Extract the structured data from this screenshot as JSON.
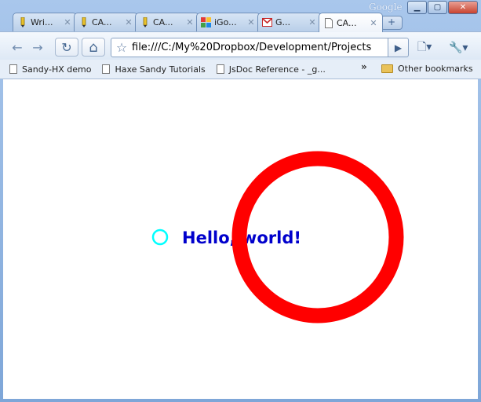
{
  "window": {
    "brand_label": "Google",
    "minimize_label": "▁",
    "maximize_label": "▢",
    "close_label": "✕"
  },
  "tabs": [
    {
      "title": "Wri...",
      "icon": "pencil-icon",
      "active": false
    },
    {
      "title": "CA...",
      "icon": "pencil-icon",
      "active": false
    },
    {
      "title": "CA...",
      "icon": "pencil-icon",
      "active": false
    },
    {
      "title": "iGo...",
      "icon": "google-icon",
      "active": false
    },
    {
      "title": "G...",
      "icon": "gmail-icon",
      "active": false
    },
    {
      "title": "CA...",
      "icon": "page-icon",
      "active": true
    }
  ],
  "tab_close_label": "✕",
  "new_tab_label": "+",
  "toolbar": {
    "back_icon": "←",
    "forward_icon": "→",
    "reload_icon": "↻",
    "home_icon": "⌂",
    "star_icon": "☆",
    "url": "file:///C:/My%20Dropbox/Development/Projects",
    "go_icon": "▶",
    "page_menu_icon": "🗋▾",
    "tools_menu_icon": "🔧▾"
  },
  "bookmarks": {
    "items": [
      "Sandy-HX demo",
      "Haxe Sandy Tutorials",
      "JsDoc Reference - _g..."
    ],
    "overflow_label": "»",
    "other_label": "Other bookmarks"
  },
  "canvas": {
    "text": "Hello, world!",
    "text_color": "#0000cc",
    "small_circle_color": "#00ffff",
    "big_circle_color": "#ff0000"
  }
}
